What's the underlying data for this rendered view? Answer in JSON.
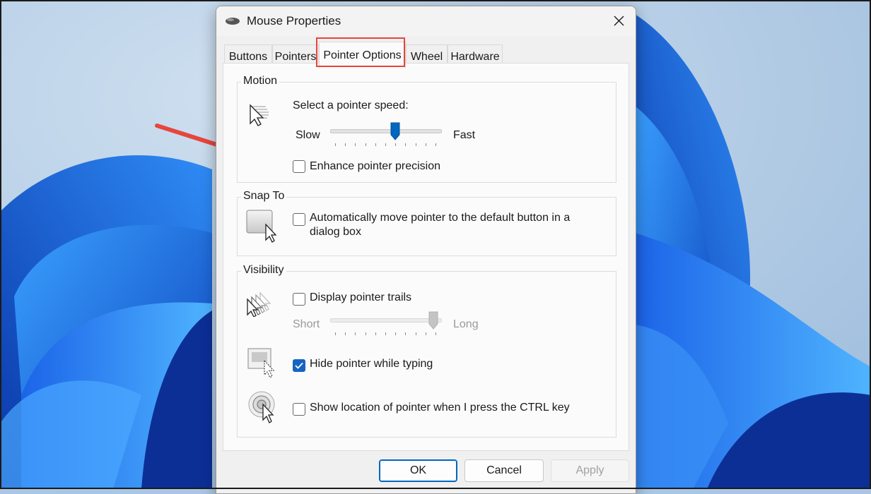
{
  "dialog": {
    "title": "Mouse Properties",
    "close_label": "Close"
  },
  "tabs": [
    {
      "label": "Buttons"
    },
    {
      "label": "Pointers"
    },
    {
      "label": "Pointer Options"
    },
    {
      "label": "Wheel"
    },
    {
      "label": "Hardware"
    }
  ],
  "active_tab": "Pointer Options",
  "motion": {
    "group_label": "Motion",
    "speed_label": "Select a pointer speed:",
    "slow_label": "Slow",
    "fast_label": "Fast",
    "speed_value_fraction": 0.6,
    "enhance_label": "Enhance pointer precision",
    "enhance_checked": false
  },
  "snap_to": {
    "group_label": "Snap To",
    "auto_move_label_line1": "Automatically move pointer to the default button in a",
    "auto_move_label_line2": "dialog box",
    "auto_move_checked": false
  },
  "visibility": {
    "group_label": "Visibility",
    "trails_label": "Display pointer trails",
    "trails_checked": false,
    "short_label": "Short",
    "long_label": "Long",
    "trails_value_fraction": 1.0,
    "hide_typing_label": "Hide pointer while typing",
    "hide_typing_checked": true,
    "show_ctrl_label": "Show location of pointer when I press the CTRL key",
    "show_ctrl_checked": false
  },
  "buttons": {
    "ok": "OK",
    "cancel": "Cancel",
    "apply": "Apply"
  },
  "colors": {
    "accent": "#0067c0",
    "highlight": "#e8453c",
    "checkbox_checked": "#1565c0"
  }
}
